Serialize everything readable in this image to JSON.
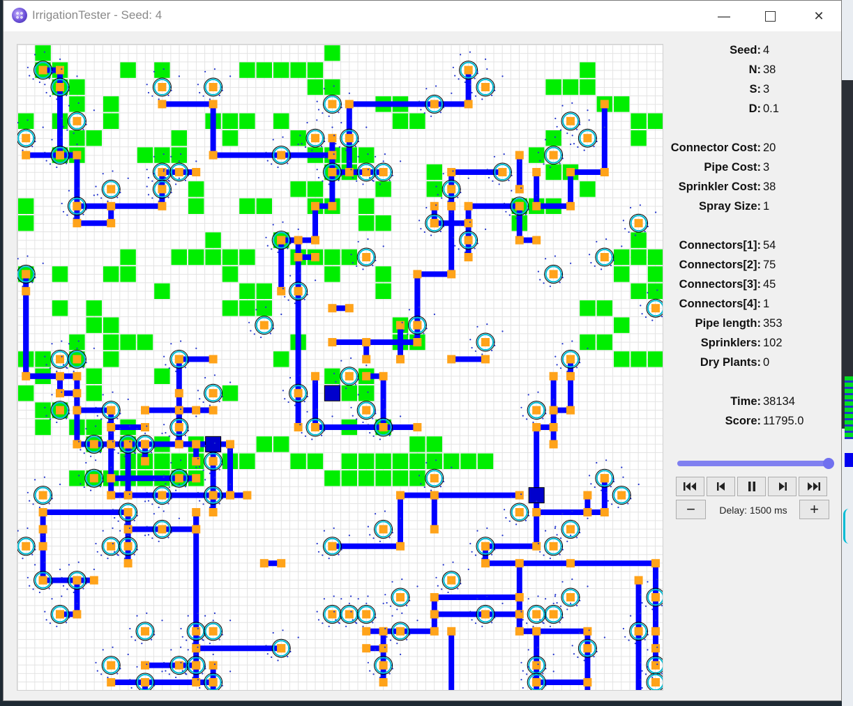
{
  "window": {
    "title": "IrrigationTester - Seed: 4",
    "controls": [
      "minimize-icon",
      "maximize-icon",
      "close-icon"
    ]
  },
  "stats": {
    "seed": {
      "label": "Seed:",
      "value": "4"
    },
    "n": {
      "label": "N:",
      "value": "38"
    },
    "s": {
      "label": "S:",
      "value": "3"
    },
    "d": {
      "label": "D:",
      "value": "0.1"
    },
    "connector_cost": {
      "label": "Connector Cost:",
      "value": "20"
    },
    "pipe_cost": {
      "label": "Pipe Cost:",
      "value": "3"
    },
    "sprinkler_cost": {
      "label": "Sprinkler Cost:",
      "value": "38"
    },
    "spray_size": {
      "label": "Spray Size:",
      "value": "1"
    },
    "connectors1": {
      "label": "Connectors[1]:",
      "value": "54"
    },
    "connectors2": {
      "label": "Connectors[2]:",
      "value": "75"
    },
    "connectors3": {
      "label": "Connectors[3]:",
      "value": "45"
    },
    "connectors4": {
      "label": "Connectors[4]:",
      "value": "1"
    },
    "pipe_length": {
      "label": "Pipe length:",
      "value": "353"
    },
    "sprinklers": {
      "label": "Sprinklers:",
      "value": "102"
    },
    "dry_plants": {
      "label": "Dry Plants:",
      "value": "0"
    },
    "time": {
      "label": "Time:",
      "value": "38134"
    },
    "score": {
      "label": "Score:",
      "value": "11795.0"
    }
  },
  "playback": {
    "slider_fraction": 1.0,
    "buttons": [
      "skip-to-start-icon",
      "step-back-icon",
      "pause-icon",
      "step-forward-icon",
      "skip-to-end-icon"
    ],
    "decrease_label": "−",
    "increase_label": "+",
    "delay_text": "Delay: 1500 ms"
  },
  "colors": {
    "pipe": "#0000ff",
    "connector": "#ffa31a",
    "plant": "#00ee00",
    "sprinkler_ring": "#00bcd4",
    "spray": "#2233cc",
    "source": "#0000cc"
  }
}
